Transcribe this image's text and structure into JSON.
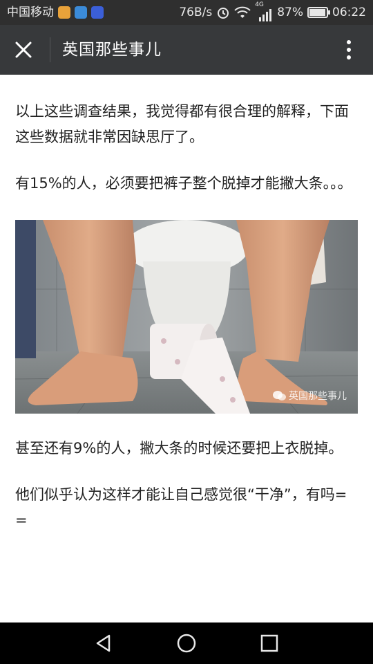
{
  "status_bar": {
    "carrier": "中国移动",
    "network_speed": "76B/s",
    "network_type": "4G",
    "battery": "87%",
    "battery_level": 0.87,
    "time": "06:22",
    "icons": [
      "app-badge-icon",
      "alarm-icon",
      "wifi-icon",
      "signal-icon",
      "battery-icon"
    ]
  },
  "app_bar": {
    "title": "英国那些事儿",
    "close_icon": "close-icon",
    "more_icon": "more-vertical-icon"
  },
  "article": {
    "paragraphs": [
      "以上这些调查结果，我觉得都有很合理的解释，下面这些数据就非常因缺思厅了。",
      "有15%的人，必须要把裤子整个脱掉才能撇大条。。。",
      "甚至还有9%的人，撇大条的时候还要把上衣脱掉。",
      "他们似乎认为这样才能让自己感觉很“干净”，有吗= ="
    ],
    "image": {
      "watermark": "英国那些事儿",
      "watermark_icon": "wechat-icon"
    }
  },
  "nav_bar": {
    "icons": [
      "back-icon",
      "home-icon",
      "recents-icon"
    ]
  },
  "colors": {
    "status_bar_bg": "#2f2f2f",
    "app_bar_bg": "#37393b",
    "nav_bar_bg": "#000000",
    "text": "#222222"
  }
}
